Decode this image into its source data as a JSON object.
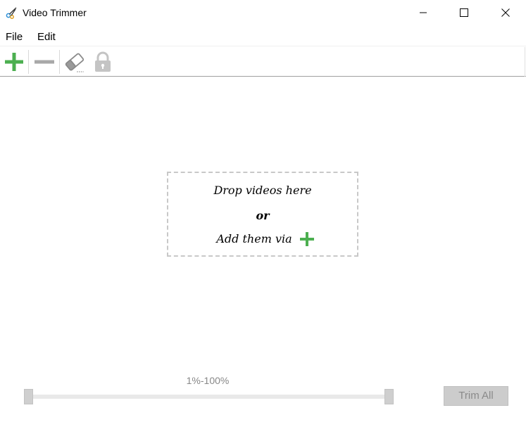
{
  "window": {
    "title": "Video Trimmer",
    "app_icon": "scissors-icon",
    "controls": [
      "minimize-icon",
      "maximize-icon",
      "close-icon"
    ]
  },
  "menu": {
    "items": [
      {
        "label": "File"
      },
      {
        "label": "Edit"
      }
    ]
  },
  "toolbar": {
    "buttons": [
      {
        "icon": "plus-icon",
        "color": "#4caf50",
        "enabled": true
      },
      {
        "icon": "minus-icon",
        "color": "#a8a8a8",
        "enabled": false
      },
      {
        "icon": "eraser-icon",
        "color": "#a8a8a8",
        "enabled": true
      },
      {
        "icon": "lock-icon",
        "color": "#c0c0c0",
        "enabled": false
      }
    ]
  },
  "dropzone": {
    "line1": "Drop videos here",
    "line2": "or",
    "line3": "Add them via",
    "plus_icon": "plus-icon",
    "accent": "#4caf50"
  },
  "range": {
    "label": "1%-100%",
    "start_fraction": 0.01,
    "end_fraction": 1.0
  },
  "actions": {
    "trim_all_label": "Trim All",
    "trim_all_enabled": false
  }
}
